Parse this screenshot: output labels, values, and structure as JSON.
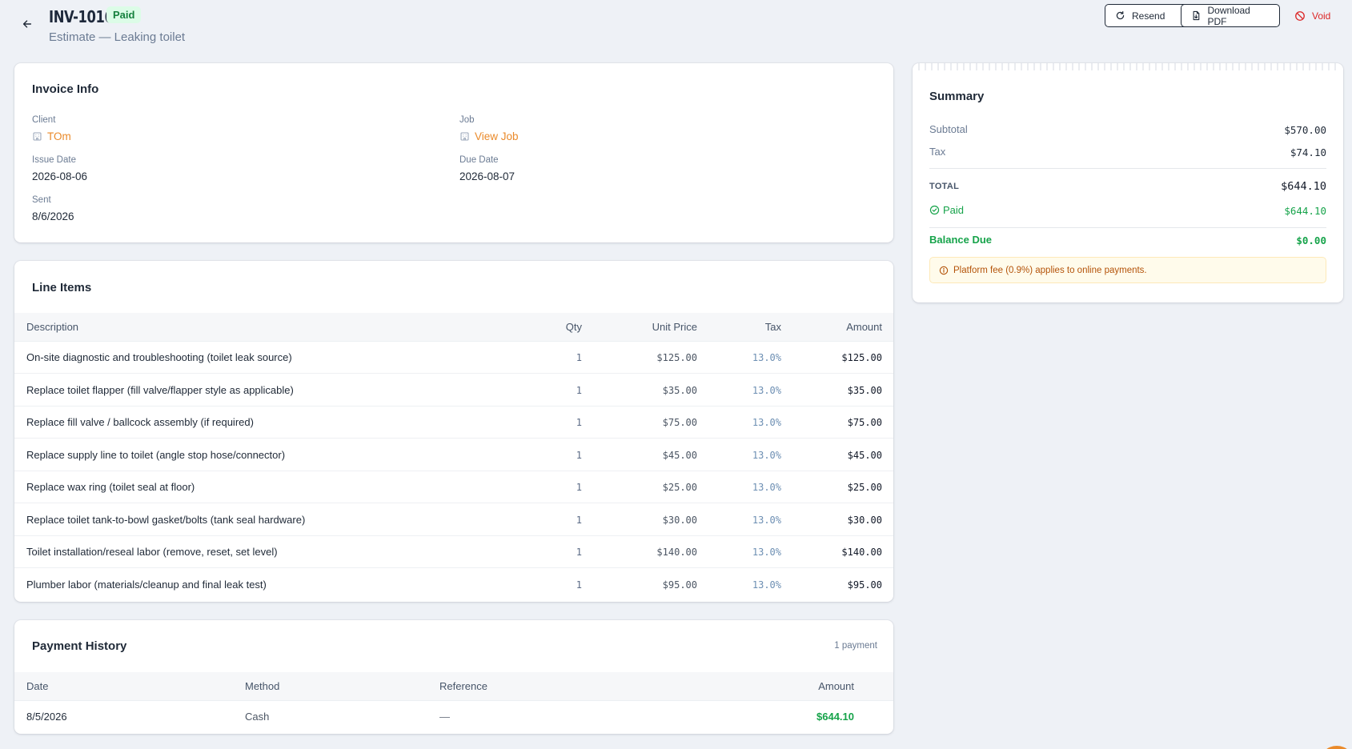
{
  "header": {
    "invoice_number": "INV-1016",
    "status": "Paid",
    "subtitle": "Estimate — Leaking toilet",
    "resend_label": "Resend",
    "download_label": "Download PDF",
    "void_label": "Void"
  },
  "info": {
    "title": "Invoice Info",
    "client_label": "Client",
    "client_value": "TOm",
    "job_label": "Job",
    "job_value": "View Job",
    "issue_label": "Issue Date",
    "issue_value": "2026-08-06",
    "due_label": "Due Date",
    "due_value": "2026-08-07",
    "sent_label": "Sent",
    "sent_value": "8/6/2026"
  },
  "line_items": {
    "title": "Line Items",
    "columns": {
      "description": "Description",
      "qty": "Qty",
      "unit_price": "Unit Price",
      "tax": "Tax",
      "amount": "Amount"
    },
    "rows": [
      {
        "description": "On-site diagnostic and troubleshooting (toilet leak source)",
        "qty": "1",
        "unit_price": "$125.00",
        "tax": "13.0%",
        "amount": "$125.00"
      },
      {
        "description": "Replace toilet flapper (fill valve/flapper style as applicable)",
        "qty": "1",
        "unit_price": "$35.00",
        "tax": "13.0%",
        "amount": "$35.00"
      },
      {
        "description": "Replace fill valve / ballcock assembly (if required)",
        "qty": "1",
        "unit_price": "$75.00",
        "tax": "13.0%",
        "amount": "$75.00"
      },
      {
        "description": "Replace supply line to toilet (angle stop hose/connector)",
        "qty": "1",
        "unit_price": "$45.00",
        "tax": "13.0%",
        "amount": "$45.00"
      },
      {
        "description": "Replace wax ring (toilet seal at floor)",
        "qty": "1",
        "unit_price": "$25.00",
        "tax": "13.0%",
        "amount": "$25.00"
      },
      {
        "description": "Replace toilet tank-to-bowl gasket/bolts (tank seal hardware)",
        "qty": "1",
        "unit_price": "$30.00",
        "tax": "13.0%",
        "amount": "$30.00"
      },
      {
        "description": "Toilet installation/reseal labor (remove, reset, set level)",
        "qty": "1",
        "unit_price": "$140.00",
        "tax": "13.0%",
        "amount": "$140.00"
      },
      {
        "description": "Plumber labor (materials/cleanup and final leak test)",
        "qty": "1",
        "unit_price": "$95.00",
        "tax": "13.0%",
        "amount": "$95.00"
      }
    ]
  },
  "payments": {
    "title": "Payment History",
    "count": "1 payment",
    "columns": {
      "date": "Date",
      "method": "Method",
      "reference": "Reference",
      "amount": "Amount"
    },
    "rows": [
      {
        "date": "8/5/2026",
        "method": "Cash",
        "reference": "—",
        "amount": "$644.10"
      }
    ]
  },
  "summary": {
    "title": "Summary",
    "subtotal_label": "Subtotal",
    "subtotal_value": "$570.00",
    "tax_label": "Tax",
    "tax_value": "$74.10",
    "total_label": "TOTAL",
    "total_value": "$644.10",
    "paid_label": "Paid",
    "paid_value": "$644.10",
    "balance_label": "Balance Due",
    "balance_value": "$0.00",
    "fee_note": "Platform fee (0.9%) applies to online payments."
  },
  "colors": {
    "accent": "#ea8a2a",
    "success": "#16a34a",
    "danger": "#dc2626",
    "background": "#eef1f6"
  },
  "icons": [
    "arrow-left-icon",
    "refresh-icon",
    "file-download-icon",
    "ban-icon",
    "building-icon",
    "check-circle-icon",
    "info-circle-icon"
  ]
}
